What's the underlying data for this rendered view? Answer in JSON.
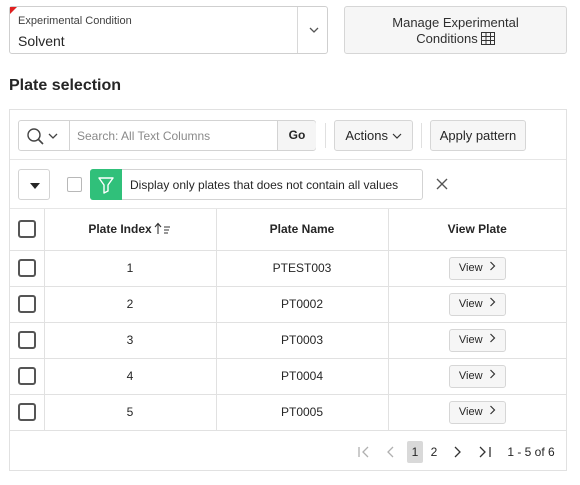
{
  "condition_field": {
    "label": "Experimental Condition",
    "value": "Solvent"
  },
  "manage_button": {
    "line1": "Manage Experimental",
    "line2": "Conditions"
  },
  "section": {
    "title": "Plate selection"
  },
  "toolbar": {
    "search_placeholder": "Search: All Text Columns",
    "go_label": "Go",
    "actions_label": "Actions",
    "apply_label": "Apply pattern"
  },
  "filter": {
    "text": "Display only plates that does not contain all values"
  },
  "table": {
    "headers": [
      "Plate Index",
      "Plate Name",
      "View Plate"
    ],
    "view_label": "View",
    "rows": [
      {
        "index": "1",
        "name": "PTEST003"
      },
      {
        "index": "2",
        "name": "PT0002"
      },
      {
        "index": "3",
        "name": "PT0003"
      },
      {
        "index": "4",
        "name": "PT0004"
      },
      {
        "index": "5",
        "name": "PT0005"
      }
    ]
  },
  "pagination": {
    "pages": [
      "1",
      "2"
    ],
    "current_page": "1",
    "summary": "1 - 5 of 6"
  },
  "colors": {
    "filter_accent": "#30c07a",
    "required_flag": "#e02020"
  },
  "icons": [
    "chevron-down-icon",
    "grid-icon",
    "search-icon",
    "filter-icon",
    "close-icon",
    "sort-ascending-icon",
    "chevron-right-icon",
    "first-page-icon",
    "previous-page-icon",
    "next-page-icon",
    "last-page-icon"
  ]
}
